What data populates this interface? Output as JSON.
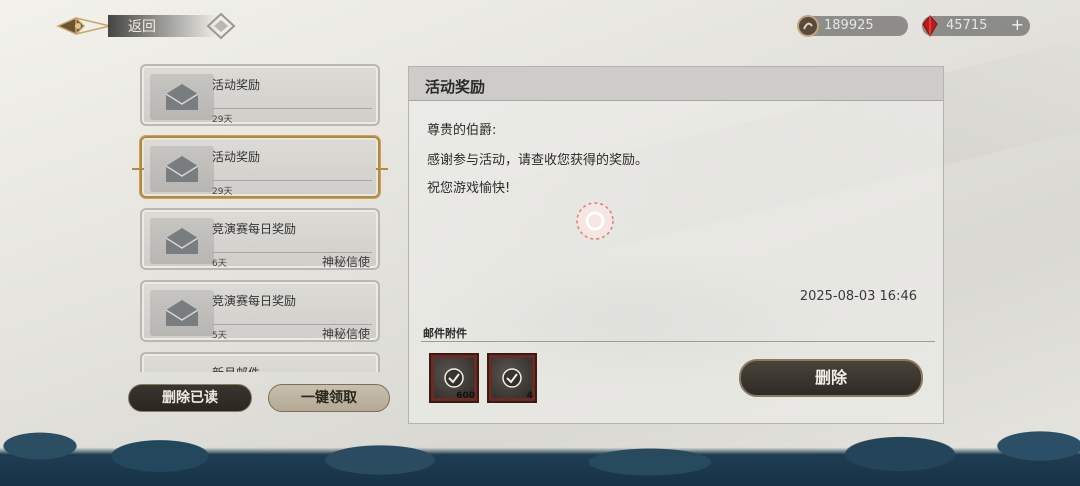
{
  "topbar": {
    "back_label": "返回",
    "currency": [
      {
        "icon": "coin-icon",
        "value": "189925"
      },
      {
        "icon": "red-gem-icon",
        "value": "45715",
        "plus": "+"
      }
    ]
  },
  "mail_list": [
    {
      "title": "活动奖励",
      "days": "29天",
      "sender": "",
      "selected": false
    },
    {
      "title": "活动奖励",
      "days": "29天",
      "sender": "",
      "selected": true
    },
    {
      "title": "竞演赛每日奖励",
      "days": "6天",
      "sender": "神秘信使",
      "selected": false
    },
    {
      "title": "竞演赛每日奖励",
      "days": "5天",
      "sender": "神秘信使",
      "selected": false
    },
    {
      "title": "新月邮件",
      "days": "",
      "sender": "",
      "selected": false
    }
  ],
  "actions": {
    "delete_read": "删除已读",
    "claim_all": "一键领取"
  },
  "detail": {
    "title": "活动奖励",
    "body": [
      "尊贵的伯爵:",
      "感谢参与活动，请查收您获得的奖励。",
      "祝您游戏愉快!"
    ],
    "timestamp": "2025-08-03   16:46",
    "attachments_label": "邮件附件",
    "attachments": [
      {
        "qty": "600"
      },
      {
        "qty": "4"
      }
    ],
    "delete_label": "删除"
  },
  "colors": {
    "gold_border": "#b08a44",
    "slot_red": "#6b2a24",
    "sea_blue": "#1f3d52"
  }
}
